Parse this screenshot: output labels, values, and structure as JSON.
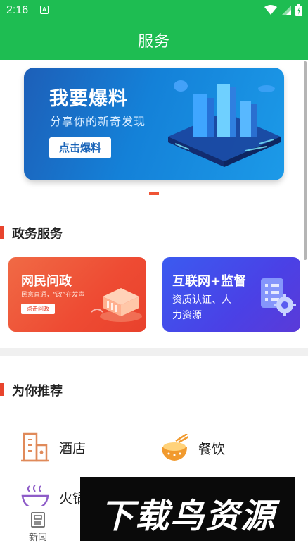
{
  "status_bar": {
    "time": "2:16",
    "notif_icon": "A"
  },
  "title_bar": {
    "title": "服务"
  },
  "banner": {
    "title": "我要爆料",
    "subtitle": "分享你的新奇发现",
    "button": "点击爆料"
  },
  "gov_section": {
    "title": "政务服务",
    "cards": [
      {
        "title": "网民问政",
        "subtitle": "民意直通，“政”在发声",
        "button": "点击问政"
      },
      {
        "title": "互联网+监督",
        "subtitle": "资质认证、人力资源"
      }
    ]
  },
  "rec_section": {
    "title": "为你推荐",
    "items": [
      {
        "label": "酒店",
        "icon": "hotel-icon"
      },
      {
        "label": "餐饮",
        "icon": "dining-icon"
      },
      {
        "label": "火锅",
        "icon": "hotpot-icon"
      }
    ]
  },
  "bottom_nav": {
    "items": [
      {
        "label": "新闻",
        "icon": "news-icon"
      },
      {
        "label": "",
        "icon": "tab2-icon"
      },
      {
        "label": "",
        "icon": "service-icon"
      },
      {
        "label": "",
        "icon": "mine-icon"
      }
    ]
  },
  "watermark": {
    "text": "下载鸟资源"
  },
  "colors": {
    "primary_green": "#1ebd52",
    "accent_red": "#e8442d",
    "banner_blue": "#1481d8"
  }
}
